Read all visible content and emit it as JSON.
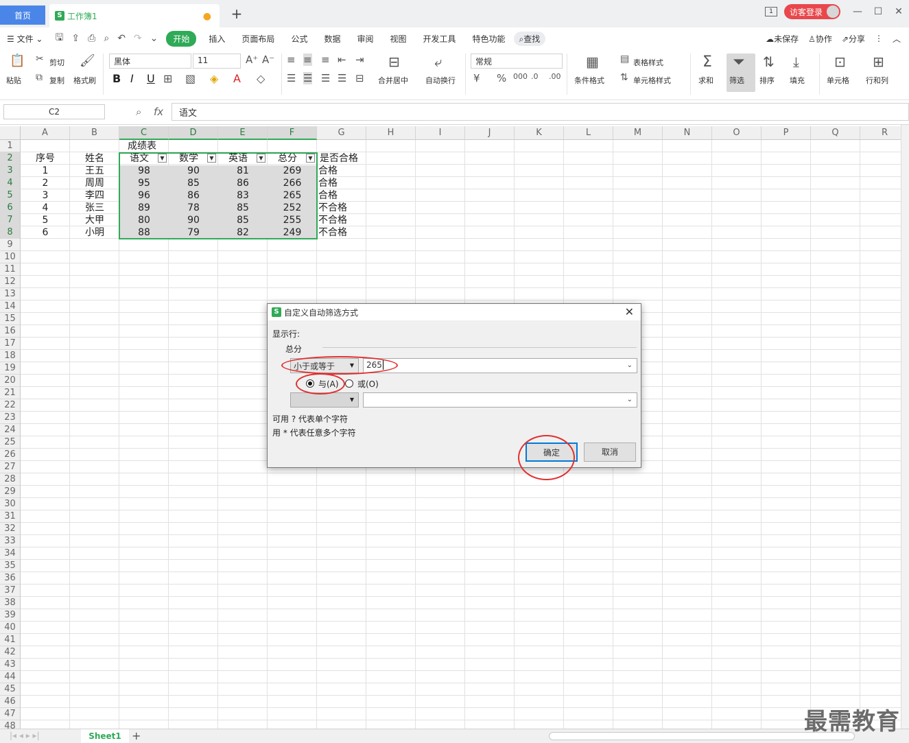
{
  "titlebar": {
    "home_tab": "首页",
    "doc_tab": "工作簿1",
    "login": "访客登录"
  },
  "menu": {
    "file": "文件",
    "items": [
      "开始",
      "插入",
      "页面布局",
      "公式",
      "数据",
      "审阅",
      "视图",
      "开发工具",
      "特色功能"
    ],
    "search": "查找",
    "unsaved": "未保存",
    "collab": "协作",
    "share": "分享"
  },
  "ribbon": {
    "paste": "粘贴",
    "cut": "剪切",
    "copy": "复制",
    "format_painter": "格式刷",
    "font": "黑体",
    "font_size": "11",
    "merge_center": "合并居中",
    "wrap": "自动换行",
    "number_format": "常规",
    "cond_format": "条件格式",
    "table_style": "表格样式",
    "cell_style": "单元格样式",
    "sum": "求和",
    "filter": "筛选",
    "sort": "排序",
    "fill": "填充",
    "cell": "单元格",
    "row_col": "行和列"
  },
  "formula_bar": {
    "name_box": "C2",
    "fx": "fx",
    "value": "语文"
  },
  "sheet": {
    "columns": [
      "A",
      "B",
      "C",
      "D",
      "E",
      "F",
      "G",
      "H",
      "I",
      "J",
      "K",
      "L",
      "M",
      "N",
      "O",
      "P",
      "Q",
      "R"
    ],
    "title": "成绩表",
    "headers": [
      "序号",
      "姓名",
      "语文",
      "数学",
      "英语",
      "总分",
      "是否合格"
    ],
    "rows": [
      [
        "1",
        "王五",
        "98",
        "90",
        "81",
        "269",
        "合格"
      ],
      [
        "2",
        "周周",
        "95",
        "85",
        "86",
        "266",
        "合格"
      ],
      [
        "3",
        "李四",
        "96",
        "86",
        "83",
        "265",
        "合格"
      ],
      [
        "4",
        "张三",
        "89",
        "78",
        "85",
        "252",
        "不合格"
      ],
      [
        "5",
        "大甲",
        "80",
        "90",
        "85",
        "255",
        "不合格"
      ],
      [
        "6",
        "小明",
        "88",
        "79",
        "82",
        "249",
        "不合格"
      ]
    ],
    "tab": "Sheet1"
  },
  "dialog": {
    "title": "自定义自动筛选方式",
    "show_rows": "显示行:",
    "field": "总分",
    "operator1": "小于或等于",
    "value1": "265",
    "and_label": "与(A)",
    "or_label": "或(O)",
    "operator2": "",
    "value2": "",
    "hint1": "可用 ? 代表单个字符",
    "hint2": "用 * 代表任意多个字符",
    "ok": "确定",
    "cancel": "取消"
  },
  "watermark": "最需教育",
  "colors": {
    "accent_green": "#2faa57",
    "home_tab_blue": "#4a86e8",
    "login_red": "#e8484c",
    "annotation_red": "#e03030",
    "ok_border_blue": "#0078d7"
  }
}
